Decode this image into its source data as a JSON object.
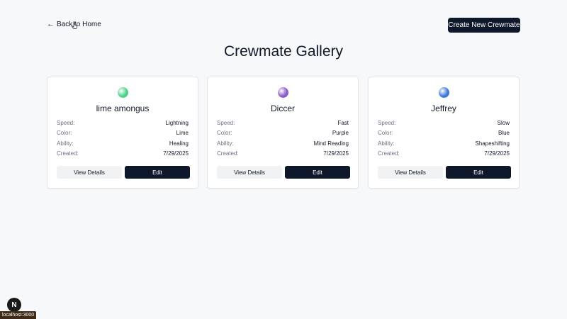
{
  "header": {
    "back_arrow": "←",
    "back_label": "Back to Home",
    "create_label": "Create New Crewmate",
    "title": "Crewmate Gallery"
  },
  "labels": {
    "speed": "Speed:",
    "color": "Color:",
    "ability": "Ability:",
    "created": "Created:"
  },
  "buttons": {
    "view": "View Details",
    "edit": "Edit"
  },
  "crewmates": [
    {
      "name": "lime amongus",
      "speed": "Lightning",
      "color": "Lime",
      "ability": "Healing",
      "created": "7/29/2025",
      "orb_color": "#4fd08a"
    },
    {
      "name": "Diccer",
      "speed": "Fast",
      "color": "Purple",
      "ability": "Mind Reading",
      "created": "7/29/2025",
      "orb_color": "#8b5cc9"
    },
    {
      "name": "Jeffrey",
      "speed": "Slow",
      "color": "Blue",
      "ability": "Shapeshifting",
      "created": "7/29/2025",
      "orb_color": "#3f78d4"
    }
  ],
  "overlay": {
    "next_badge": "N",
    "status_url": "localhost:3000"
  },
  "icons": {
    "cursor": "hand-pointer-icon",
    "dev": "nextjs-logo-icon"
  }
}
